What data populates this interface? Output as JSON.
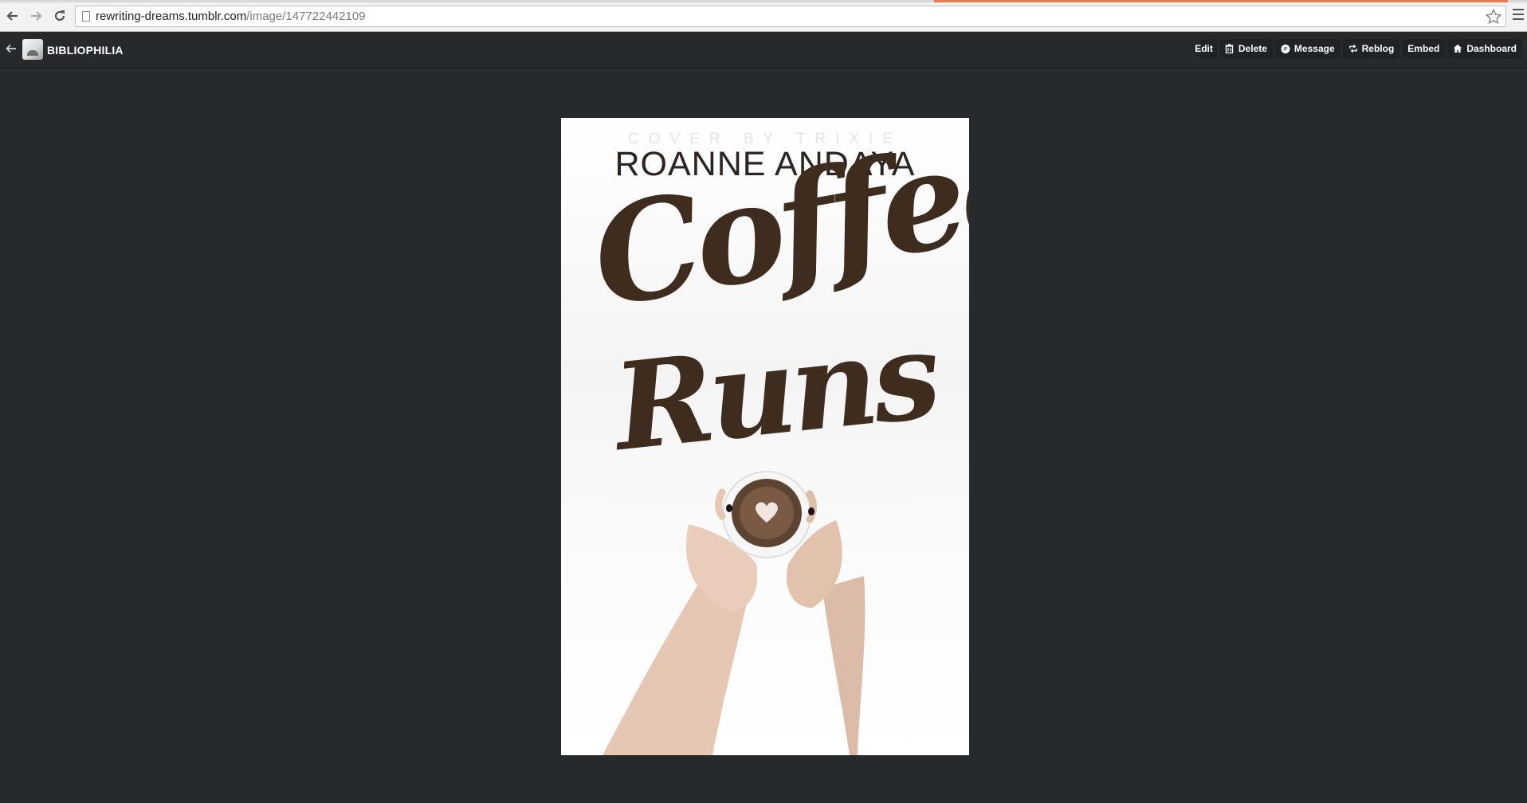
{
  "browser": {
    "url_host": "rewriting-dreams.tumblr.com",
    "url_path": "/image/147722442109"
  },
  "tumblr_bar": {
    "blog_name": "BIBLIOPHILIA",
    "actions": {
      "edit": "Edit",
      "delete": "Delete",
      "message": "Message",
      "reblog": "Reblog",
      "embed": "Embed",
      "dashboard": "Dashboard"
    }
  },
  "cover": {
    "credit": "COVER BY TRIXIE",
    "author": "ROANNE ANDAYA",
    "title_line1": "Coffee",
    "title_line2": "Runs"
  },
  "colors": {
    "page_background": "#262a2d",
    "title_brown": "#3e2c1f",
    "tab_accent": "#e8794c"
  }
}
